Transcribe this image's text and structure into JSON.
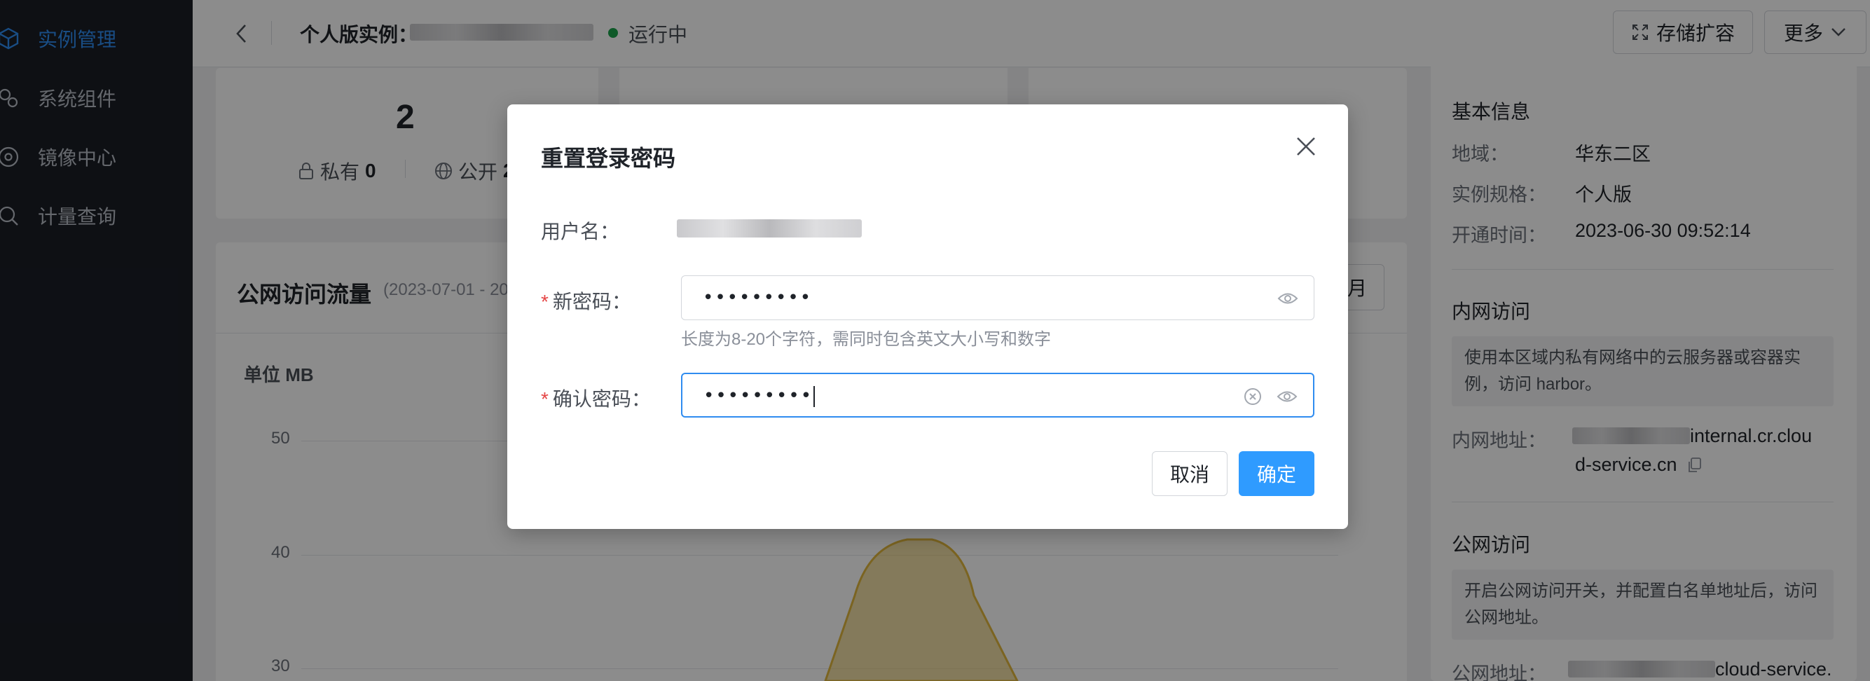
{
  "sidebar": {
    "items": [
      {
        "label": "实例管理",
        "icon": "cube-icon",
        "active": true
      },
      {
        "label": "系统组件",
        "icon": "component-icon",
        "active": false
      },
      {
        "label": "镜像中心",
        "icon": "disc-icon",
        "active": false
      },
      {
        "label": "计量查询",
        "icon": "search-icon",
        "active": false
      }
    ]
  },
  "header": {
    "title": "个人版实例：",
    "status": "运行中",
    "expand_button": "存储扩容",
    "more_button": "更多"
  },
  "stats": {
    "total": "2",
    "private_label": "私有",
    "private_value": "0",
    "public_label": "公开",
    "public_value": "2"
  },
  "traffic": {
    "title": "公网访问流量",
    "date_range": "(2023-07-01 - 20",
    "button_partial": "月",
    "unit": "单位 MB",
    "y_ticks": [
      "50",
      "40",
      "30"
    ]
  },
  "right_panel": {
    "basic_title": "基本信息",
    "region_label": "地域：",
    "region_value": "华东二区",
    "spec_label": "实例规格：",
    "spec_value": "个人版",
    "open_label": "开通时间：",
    "open_value": "2023-06-30 09:52:14",
    "intranet_title": "内网访问",
    "intranet_note": "使用本区域内私有网络中的云服务器或容器实例，访问 harbor。",
    "intranet_addr_label": "内网地址：",
    "intranet_addr_line1": "internal.cr.clou",
    "intranet_addr_line2": "d-service.cn",
    "public_title": "公网访问",
    "public_note": "开启公网访问开关，并配置白名单地址后，访问公网地址。",
    "public_addr_label": "公网地址：",
    "public_addr_value": "cloud-service."
  },
  "modal": {
    "title": "重置登录密码",
    "username_label": "用户名：",
    "new_password_label": "新密码：",
    "new_password_value": "•••••••••",
    "hint": "长度为8-20个字符，需同时包含英文大小写和数字",
    "confirm_password_label": "确认密码：",
    "confirm_password_value": "•••••••••",
    "cancel": "取消",
    "ok": "确定"
  },
  "colors": {
    "accent": "#2f8cf0",
    "primary_button": "#2f9bff",
    "status_running": "#1aa34a",
    "required": "#e54545",
    "chart_fill": "#e6c35c"
  }
}
